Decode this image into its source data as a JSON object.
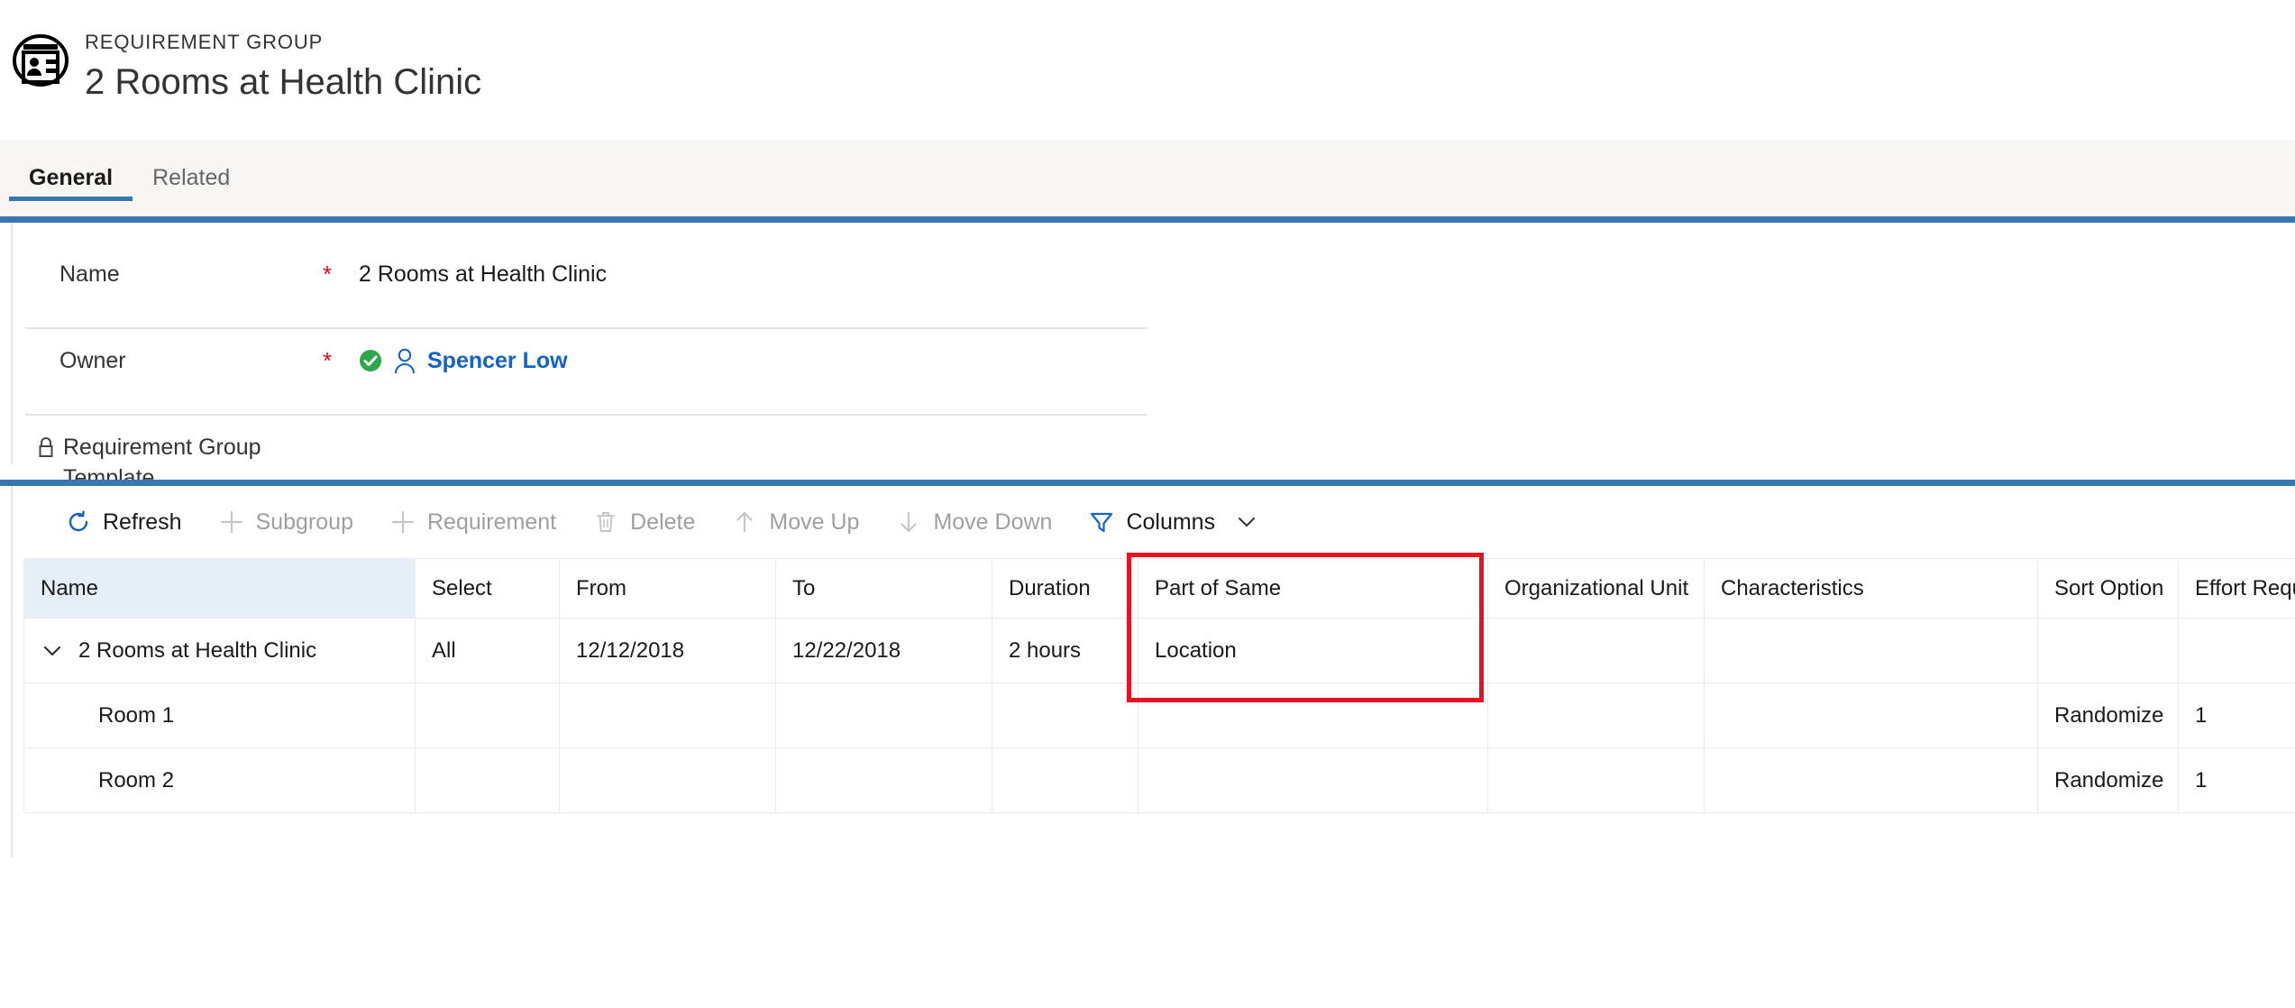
{
  "header": {
    "entity_type": "REQUIREMENT GROUP",
    "record_title": "2 Rooms at Health Clinic",
    "icon": "id-card-person-icon"
  },
  "tabs": [
    {
      "label": "General",
      "active": true
    },
    {
      "label": "Related",
      "active": false
    }
  ],
  "form": {
    "fields": [
      {
        "label": "Name",
        "required": "*",
        "value": "2 Rooms at Health Clinic",
        "locked": false,
        "type": "text"
      },
      {
        "label": "Owner",
        "required": "*",
        "value": "Spencer Low",
        "locked": false,
        "type": "lookup",
        "status_icon": "green-check-icon",
        "entity_icon": "person-icon"
      },
      {
        "label": "Requirement Group Template",
        "required": "",
        "value": "---",
        "locked": true,
        "lock_icon": "lock-icon",
        "type": "text"
      }
    ]
  },
  "command_bar": {
    "commands": [
      {
        "label": "Refresh",
        "icon": "refresh-icon",
        "enabled": true
      },
      {
        "label": "Subgroup",
        "icon": "plus-icon",
        "enabled": false
      },
      {
        "label": "Requirement",
        "icon": "plus-icon",
        "enabled": false
      },
      {
        "label": "Delete",
        "icon": "trash-icon",
        "enabled": false
      },
      {
        "label": "Move Up",
        "icon": "arrow-up-icon",
        "enabled": false
      },
      {
        "label": "Move Down",
        "icon": "arrow-down-icon",
        "enabled": false
      },
      {
        "label": "Columns",
        "icon": "filter-icon",
        "enabled": true,
        "chevron": "chevron-down-icon"
      }
    ]
  },
  "grid": {
    "columns": [
      {
        "label": "Name",
        "sorted": true
      },
      {
        "label": "Select",
        "sorted": false
      },
      {
        "label": "From",
        "sorted": false
      },
      {
        "label": "To",
        "sorted": false
      },
      {
        "label": "Duration",
        "sorted": false
      },
      {
        "label": "Part of Same",
        "sorted": false
      },
      {
        "label": "Organizational Unit",
        "sorted": false
      },
      {
        "label": "Characteristics",
        "sorted": false
      },
      {
        "label": "Sort Option",
        "sorted": false
      },
      {
        "label": "Effort Require",
        "sorted": false
      }
    ],
    "rows": [
      {
        "level": 0,
        "expanded": true,
        "name": "2 Rooms at Health Clinic",
        "select": "All",
        "from": "12/12/2018",
        "to": "12/22/2018",
        "duration": "2 hours",
        "part_of_same": "Location",
        "organizational_unit": "",
        "characteristics": "",
        "sort_option": "",
        "effort_required": ""
      },
      {
        "level": 1,
        "expanded": false,
        "name": "Room 1",
        "select": "",
        "from": "",
        "to": "",
        "duration": "",
        "part_of_same": "",
        "organizational_unit": "",
        "characteristics": "",
        "sort_option": "Randomize",
        "effort_required": "1"
      },
      {
        "level": 1,
        "expanded": false,
        "name": "Room 2",
        "select": "",
        "from": "",
        "to": "",
        "duration": "",
        "part_of_same": "",
        "organizational_unit": "",
        "characteristics": "",
        "sort_option": "Randomize",
        "effort_required": "1"
      }
    ]
  },
  "annotation": {
    "type": "red-highlight-box",
    "target_column": "Part of Same"
  },
  "colors": {
    "accent_blue": "#3a76b0",
    "link_blue": "#1263c8",
    "required_red": "#e00b1c",
    "annotation_red": "#e81123",
    "disabled_gray": "#a19f9d",
    "sorted_header_bg": "#e6eef7",
    "tab_strip_bg": "#f7f6f5"
  }
}
